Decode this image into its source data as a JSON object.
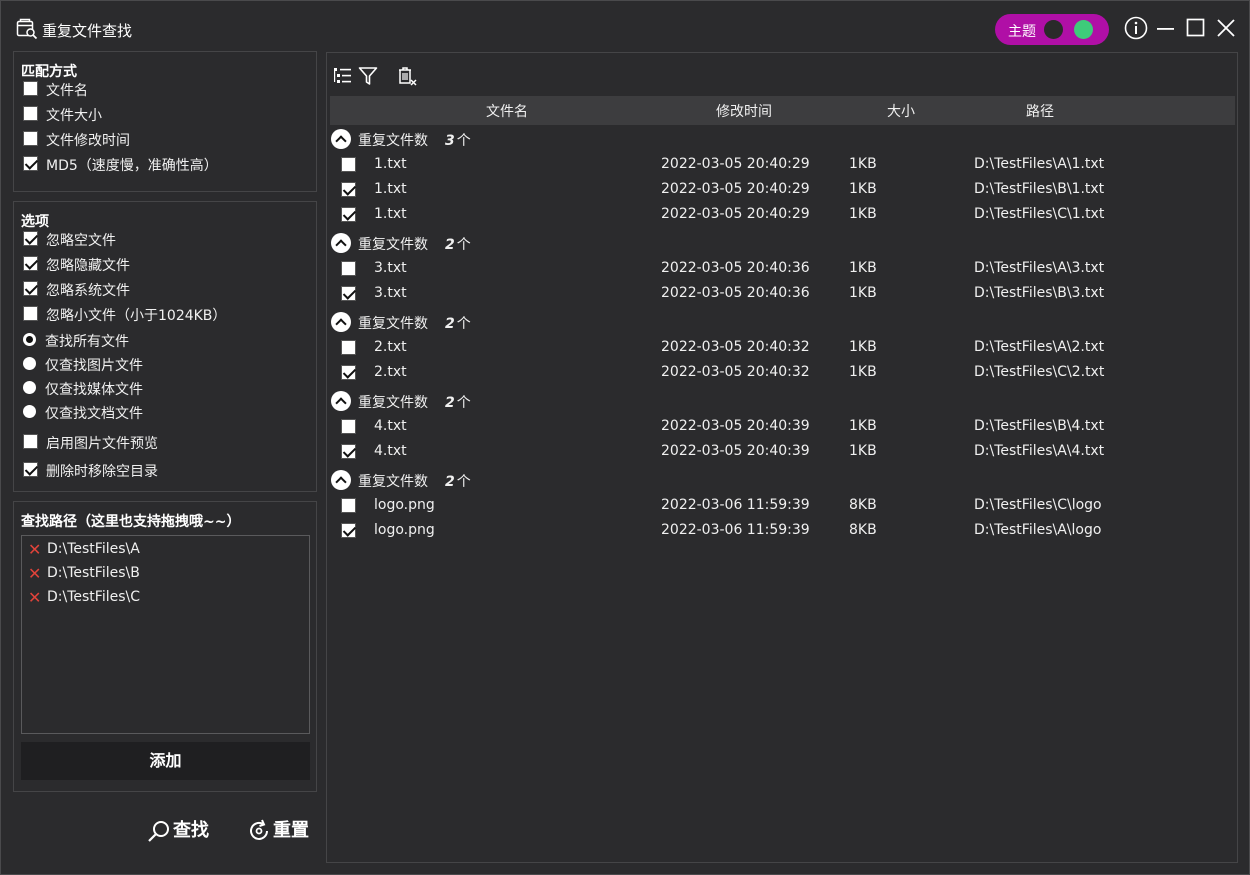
{
  "window": {
    "title": "重复文件查找"
  },
  "theme": {
    "label": "主题",
    "accent": "#b00fa6",
    "on_color": "#3ecb7a"
  },
  "match": {
    "title": "匹配方式",
    "options": [
      {
        "label": "文件名",
        "checked": false
      },
      {
        "label": "文件大小",
        "checked": false
      },
      {
        "label": "文件修改时间",
        "checked": false
      },
      {
        "label": "MD5（速度慢，准确性高）",
        "checked": true
      }
    ]
  },
  "options": {
    "title": "选项",
    "checks": [
      {
        "label": "忽略空文件",
        "checked": true
      },
      {
        "label": "忽略隐藏文件",
        "checked": true
      },
      {
        "label": "忽略系统文件",
        "checked": true
      },
      {
        "label": "忽略小文件（小于1024KB）",
        "checked": false
      }
    ],
    "radios": [
      {
        "label": "查找所有文件",
        "checked": true
      },
      {
        "label": "仅查找图片文件",
        "checked": false
      },
      {
        "label": "仅查找媒体文件",
        "checked": false
      },
      {
        "label": "仅查找文档文件",
        "checked": false
      }
    ],
    "extra": [
      {
        "label": "启用图片文件预览",
        "checked": false
      },
      {
        "label": "删除时移除空目录",
        "checked": true
      }
    ]
  },
  "paths": {
    "title": "查找路径（这里也支持拖拽哦~~）",
    "items": [
      "D:\\TestFiles\\A",
      "D:\\TestFiles\\B",
      "D:\\TestFiles\\C"
    ],
    "add_label": "添加"
  },
  "actions": {
    "search_label": "查找",
    "reset_label": "重置"
  },
  "table": {
    "columns": [
      "文件名",
      "修改时间",
      "大小",
      "路径"
    ],
    "group_label": "重复文件数",
    "count_suffix": "个",
    "groups": [
      {
        "count": "3",
        "files": [
          {
            "name": "1.txt",
            "time": "2022-03-05 20:40:29",
            "size": "1KB",
            "path": "D:\\TestFiles\\A\\1.txt",
            "checked": false
          },
          {
            "name": "1.txt",
            "time": "2022-03-05 20:40:29",
            "size": "1KB",
            "path": "D:\\TestFiles\\B\\1.txt",
            "checked": true
          },
          {
            "name": "1.txt",
            "time": "2022-03-05 20:40:29",
            "size": "1KB",
            "path": "D:\\TestFiles\\C\\1.txt",
            "checked": true
          }
        ]
      },
      {
        "count": "2",
        "files": [
          {
            "name": "3.txt",
            "time": "2022-03-05 20:40:36",
            "size": "1KB",
            "path": "D:\\TestFiles\\A\\3.txt",
            "checked": false
          },
          {
            "name": "3.txt",
            "time": "2022-03-05 20:40:36",
            "size": "1KB",
            "path": "D:\\TestFiles\\B\\3.txt",
            "checked": true
          }
        ]
      },
      {
        "count": "2",
        "files": [
          {
            "name": "2.txt",
            "time": "2022-03-05 20:40:32",
            "size": "1KB",
            "path": "D:\\TestFiles\\A\\2.txt",
            "checked": false
          },
          {
            "name": "2.txt",
            "time": "2022-03-05 20:40:32",
            "size": "1KB",
            "path": "D:\\TestFiles\\C\\2.txt",
            "checked": true
          }
        ]
      },
      {
        "count": "2",
        "files": [
          {
            "name": "4.txt",
            "time": "2022-03-05 20:40:39",
            "size": "1KB",
            "path": "D:\\TestFiles\\B\\4.txt",
            "checked": false
          },
          {
            "name": "4.txt",
            "time": "2022-03-05 20:40:39",
            "size": "1KB",
            "path": "D:\\TestFiles\\A\\4.txt",
            "checked": true
          }
        ]
      },
      {
        "count": "2",
        "files": [
          {
            "name": "logo.png",
            "time": "2022-03-06 11:59:39",
            "size": "8KB",
            "path": "D:\\TestFiles\\C\\logo",
            "checked": false
          },
          {
            "name": "logo.png",
            "time": "2022-03-06 11:59:39",
            "size": "8KB",
            "path": "D:\\TestFiles\\A\\logo",
            "checked": true
          }
        ]
      }
    ]
  }
}
